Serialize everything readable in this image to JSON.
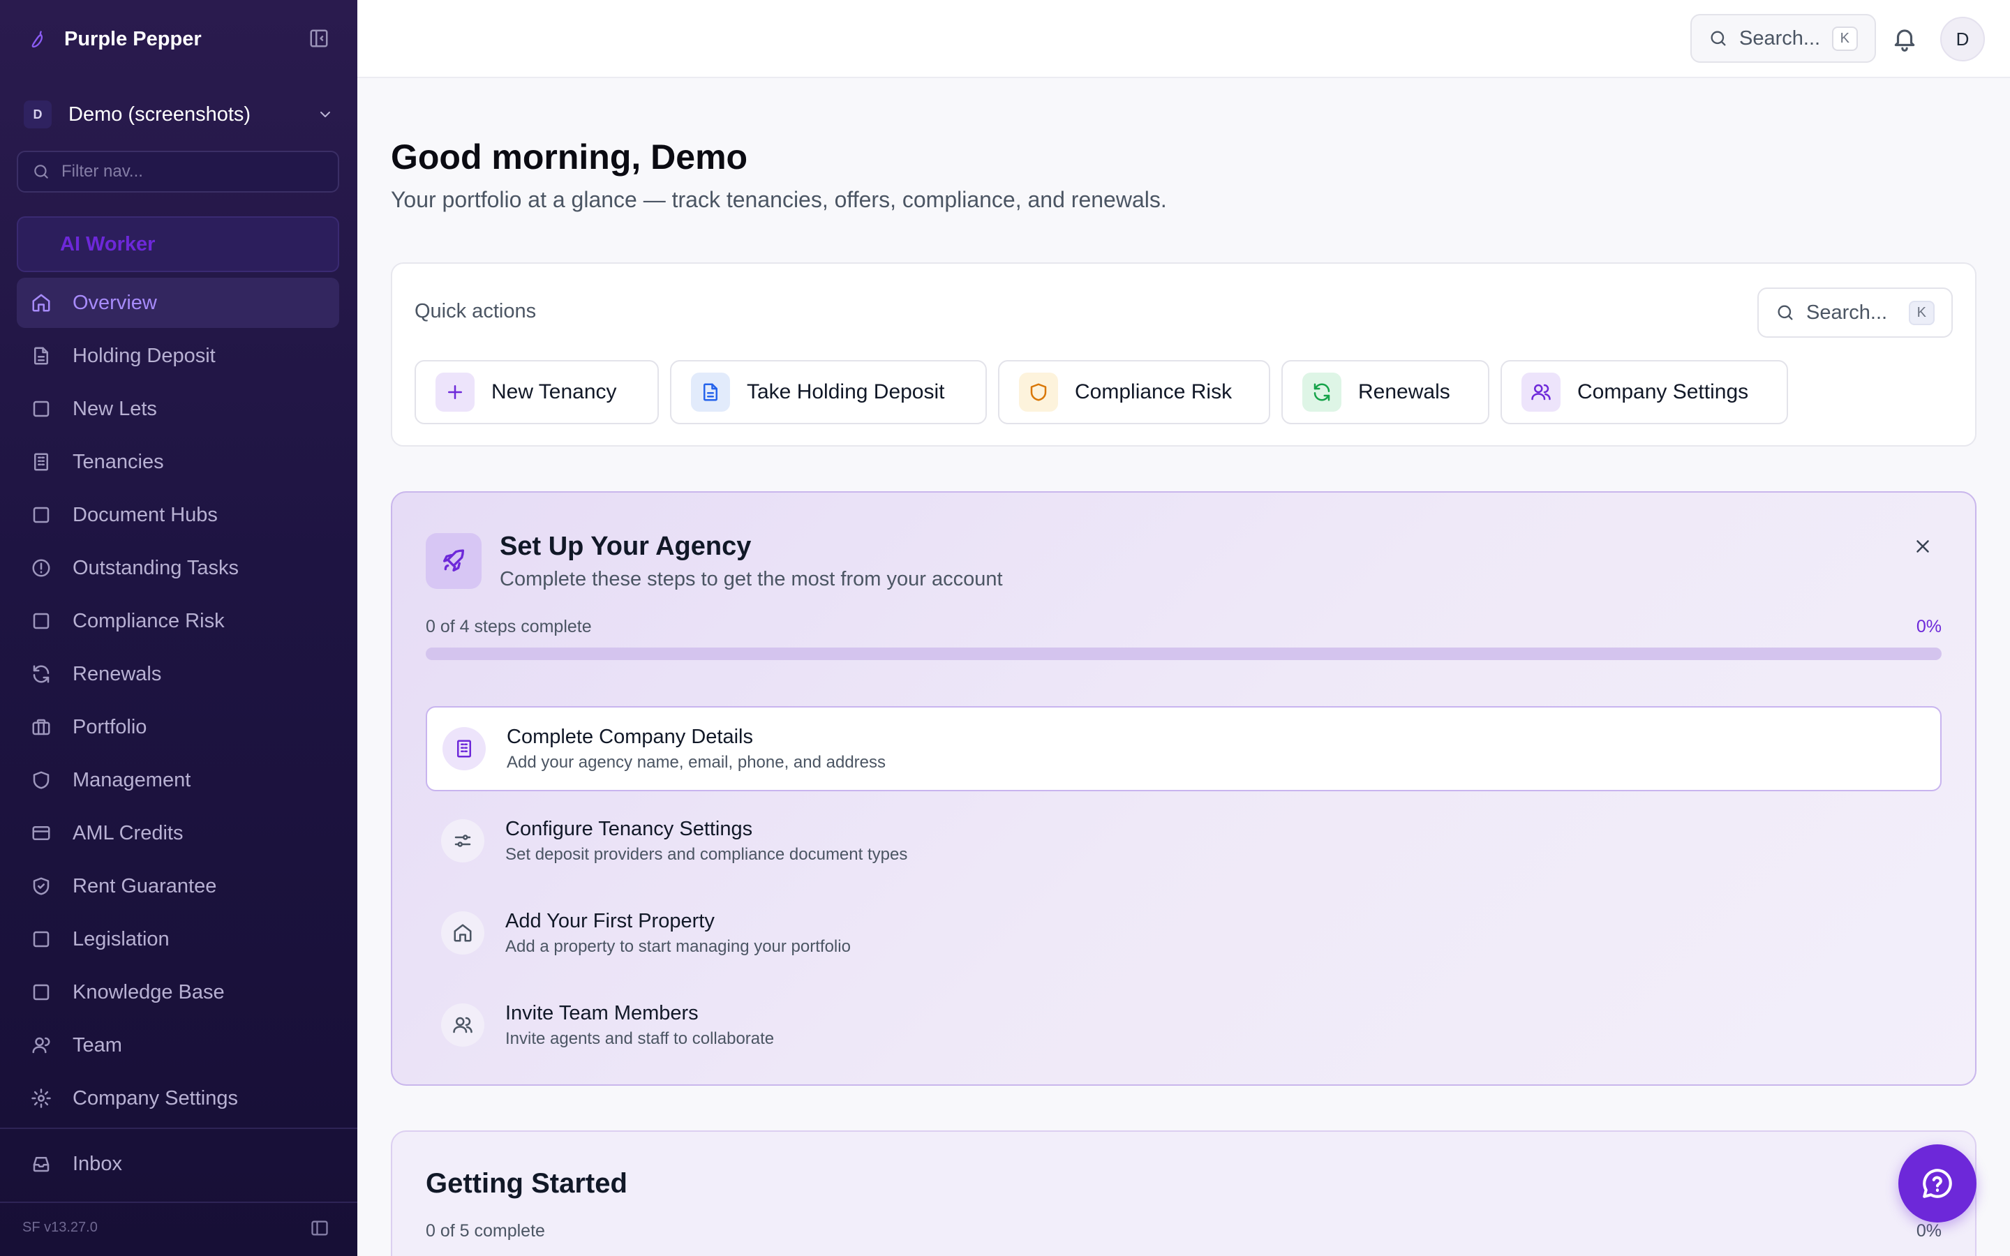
{
  "brand": {
    "name": "Purple Pepper"
  },
  "workspace": {
    "badge": "D",
    "name": "Demo (screenshots)"
  },
  "nav_filter": {
    "placeholder": "Filter nav..."
  },
  "ai_worker": {
    "label": "AI Worker"
  },
  "nav": {
    "items": [
      {
        "label": "Overview",
        "icon": "home-icon",
        "active": true
      },
      {
        "label": "Holding Deposit",
        "icon": "document-icon"
      },
      {
        "label": "New Lets",
        "icon": "square-icon"
      },
      {
        "label": "Tenancies",
        "icon": "building-icon"
      },
      {
        "label": "Document Hubs",
        "icon": "square-icon"
      },
      {
        "label": "Outstanding Tasks",
        "icon": "alert-circle-icon"
      },
      {
        "label": "Compliance Risk",
        "icon": "square-icon"
      },
      {
        "label": "Renewals",
        "icon": "refresh-icon"
      },
      {
        "label": "Portfolio",
        "icon": "briefcase-icon"
      },
      {
        "label": "Management",
        "icon": "shield-icon"
      },
      {
        "label": "AML Credits",
        "icon": "credit-card-icon"
      },
      {
        "label": "Rent Guarantee",
        "icon": "shield-check-icon"
      },
      {
        "label": "Legislation",
        "icon": "square-icon"
      },
      {
        "label": "Knowledge Base",
        "icon": "square-icon"
      },
      {
        "label": "Team",
        "icon": "user-icon"
      },
      {
        "label": "Company Settings",
        "icon": "gear-icon"
      }
    ],
    "inbox": "Inbox"
  },
  "version": "SF v13.27.0",
  "topbar": {
    "search_label": "Search...",
    "kbd": "K",
    "avatar": "D"
  },
  "main": {
    "greeting": "Good morning, Demo",
    "subtitle": "Your portfolio at a glance — track tenancies, offers, compliance, and renewals."
  },
  "quick_actions": {
    "title": "Quick actions",
    "search_label": "Search...",
    "kbd": "K",
    "buttons": [
      {
        "label": "New Tenancy",
        "icon": "plus-icon"
      },
      {
        "label": "Take Holding Deposit",
        "icon": "document-icon"
      },
      {
        "label": "Compliance Risk",
        "icon": "shield-icon"
      },
      {
        "label": "Renewals",
        "icon": "refresh-icon"
      },
      {
        "label": "Company Settings",
        "icon": "users-icon"
      }
    ]
  },
  "setup": {
    "title": "Set Up Your Agency",
    "subtitle": "Complete these steps to get the most from your account",
    "progress_label": "0 of 4 steps complete",
    "progress_pct": "0%",
    "progress_value": 0,
    "steps": [
      {
        "title": "Complete Company Details",
        "desc": "Add your agency name, email, phone, and address",
        "icon": "building-icon"
      },
      {
        "title": "Configure Tenancy Settings",
        "desc": "Set deposit providers and compliance document types",
        "icon": "sliders-icon"
      },
      {
        "title": "Add Your First Property",
        "desc": "Add a property to start managing your portfolio",
        "icon": "home-icon"
      },
      {
        "title": "Invite Team Members",
        "desc": "Invite agents and staff to collaborate",
        "icon": "users-icon"
      }
    ]
  },
  "getting_started": {
    "title": "Getting Started",
    "count": "0 of 5 complete",
    "pct": "0%"
  },
  "colors": {
    "accent": "#6d28d9",
    "sidebar_bg": "#1e1442"
  }
}
